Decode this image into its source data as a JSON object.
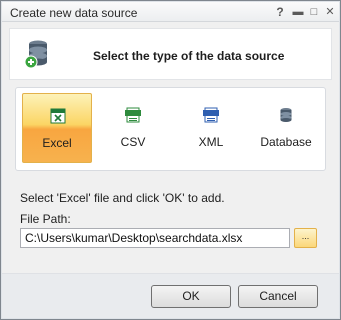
{
  "window": {
    "title": "Create new data source",
    "help_glyph": "?",
    "min_glyph": "▬",
    "max_glyph": "□",
    "close_glyph": "✕"
  },
  "header": {
    "title": "Select the type of the data source",
    "icon": "database-add-icon"
  },
  "types": [
    {
      "label": "Excel",
      "icon": "excel-icon",
      "selected": true
    },
    {
      "label": "CSV",
      "icon": "csv-icon",
      "selected": false
    },
    {
      "label": "XML",
      "icon": "xml-icon",
      "selected": false
    },
    {
      "label": "Database",
      "icon": "database-icon",
      "selected": false
    }
  ],
  "instruction": "Select 'Excel' file and click 'OK' to add.",
  "file_path": {
    "label": "File Path:",
    "value": "C:\\Users\\kumar\\Desktop\\searchdata.xlsx",
    "browse_label": "..."
  },
  "buttons": {
    "ok": "OK",
    "cancel": "Cancel"
  },
  "colors": {
    "selected_top": "#fdf2b8",
    "selected_bottom": "#f7b24e",
    "excel_green": "#1f7a3a",
    "csv_green": "#2e8b3d",
    "xml_blue": "#2f5fb0",
    "database_gray": "#4a5a6b"
  }
}
